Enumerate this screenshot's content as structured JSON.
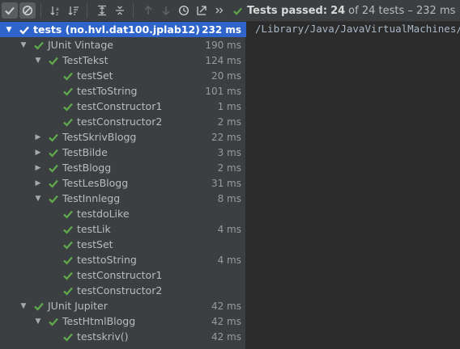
{
  "toolbar": {
    "buttons": [
      {
        "name": "show-passed-button",
        "icon": "check-icon"
      },
      {
        "name": "show-ignored-button",
        "icon": "ignored-icon"
      },
      {
        "name": "sort-alphabetically-button",
        "icon": "sort-alpha-icon"
      },
      {
        "name": "sort-by-duration-button",
        "icon": "sort-duration-icon"
      },
      {
        "name": "expand-all-button",
        "icon": "expand-all-icon"
      },
      {
        "name": "collapse-all-button",
        "icon": "collapse-all-icon"
      },
      {
        "name": "previous-failed-button",
        "icon": "arrow-up-icon"
      },
      {
        "name": "next-failed-button",
        "icon": "arrow-down-icon"
      },
      {
        "name": "test-history-button",
        "icon": "clock-icon"
      },
      {
        "name": "export-results-button",
        "icon": "export-icon"
      },
      {
        "name": "more-button",
        "icon": "double-chevron-icon"
      }
    ],
    "status_prefix": "Tests passed:",
    "status_passed": "24",
    "status_suffix": "of 24 tests – 232 ms"
  },
  "colors": {
    "pass_green": "#5fa84b",
    "selection": "#2f65ca",
    "panel": "#3c3f41",
    "console_bg": "#2b2b2b"
  },
  "tree": {
    "rows": [
      {
        "label": "tests (no.hvl.dat100.jplab12)",
        "time": "232 ms",
        "level": 0,
        "arrow": "expanded",
        "selected": true
      },
      {
        "label": "JUnit Vintage",
        "time": "190 ms",
        "level": 1,
        "arrow": "expanded"
      },
      {
        "label": "TestTekst",
        "time": "124 ms",
        "level": 2,
        "arrow": "expanded"
      },
      {
        "label": "testSet",
        "time": "20 ms",
        "level": 3,
        "arrow": "none"
      },
      {
        "label": "testToString",
        "time": "101 ms",
        "level": 3,
        "arrow": "none"
      },
      {
        "label": "testConstructor1",
        "time": "1 ms",
        "level": 3,
        "arrow": "none"
      },
      {
        "label": "testConstructor2",
        "time": "2 ms",
        "level": 3,
        "arrow": "none"
      },
      {
        "label": "TestSkrivBlogg",
        "time": "22 ms",
        "level": 2,
        "arrow": "collapsed"
      },
      {
        "label": "TestBilde",
        "time": "3 ms",
        "level": 2,
        "arrow": "collapsed"
      },
      {
        "label": "TestBlogg",
        "time": "2 ms",
        "level": 2,
        "arrow": "collapsed"
      },
      {
        "label": "TestLesBlogg",
        "time": "31 ms",
        "level": 2,
        "arrow": "collapsed"
      },
      {
        "label": "TestInnlegg",
        "time": "8 ms",
        "level": 2,
        "arrow": "expanded"
      },
      {
        "label": "testdoLike",
        "time": "",
        "level": 3,
        "arrow": "none"
      },
      {
        "label": "testLik",
        "time": "4 ms",
        "level": 3,
        "arrow": "none"
      },
      {
        "label": "testSet",
        "time": "",
        "level": 3,
        "arrow": "none"
      },
      {
        "label": "testtoString",
        "time": "4 ms",
        "level": 3,
        "arrow": "none"
      },
      {
        "label": "testConstructor1",
        "time": "",
        "level": 3,
        "arrow": "none"
      },
      {
        "label": "testConstructor2",
        "time": "",
        "level": 3,
        "arrow": "none"
      },
      {
        "label": "JUnit Jupiter",
        "time": "42 ms",
        "level": 1,
        "arrow": "expanded"
      },
      {
        "label": "TestHtmlBlogg",
        "time": "42 ms",
        "level": 2,
        "arrow": "expanded"
      },
      {
        "label": "testskriv()",
        "time": "42 ms",
        "level": 3,
        "arrow": "none"
      }
    ]
  },
  "console": {
    "line1": "/Library/Java/JavaVirtualMachines/jd"
  }
}
